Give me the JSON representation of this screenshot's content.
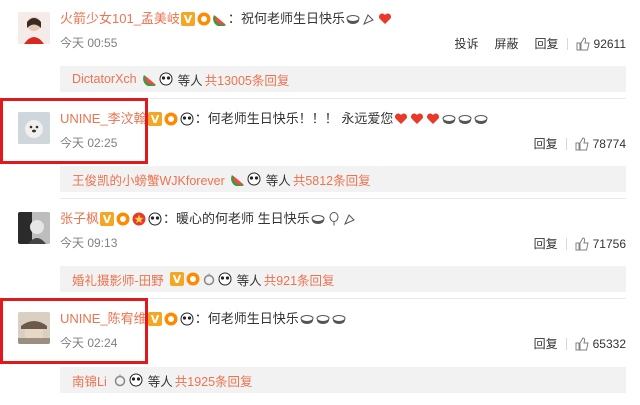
{
  "comments": [
    {
      "username": "火箭少女101_孟美岐",
      "text": "祝何老师生日快乐",
      "time": "今天 00:55",
      "actions": [
        "投诉",
        "屏蔽",
        "回复"
      ],
      "likes": "92611",
      "reply_bar": {
        "name": "DictatorXch",
        "suffix": "等人",
        "count": "共13005条回复"
      },
      "avatar_icon": "girl-red-avatar",
      "highlighted": false
    },
    {
      "username": "UNINE_李汶翰",
      "text": "何老师生日快乐！！！ 永远爱您",
      "time": "今天 02:25",
      "actions": [
        "回复"
      ],
      "likes": "78774",
      "reply_bar": {
        "name": "王俊凯的小螃蟹WJKforever",
        "suffix": "等人",
        "count": "共5812条回复"
      },
      "avatar_icon": "dog-avatar",
      "highlighted": true
    },
    {
      "username": "张子枫",
      "text": "暖心的何老师 生日快乐",
      "time": "今天 09:13",
      "actions": [
        "回复"
      ],
      "likes": "71756",
      "reply_bar": {
        "name": "婚礼摄影师-田野",
        "suffix": "等人",
        "count": "共921条回复"
      },
      "avatar_icon": "bw-portrait-avatar",
      "highlighted": false
    },
    {
      "username": "UNINE_陈宥维",
      "text": "何老师生日快乐",
      "time": "今天 02:24",
      "actions": [
        "回复"
      ],
      "likes": "65332",
      "reply_bar": {
        "name": "南锦Li",
        "suffix": "等人",
        "count": "共1925条回复"
      },
      "avatar_icon": "hat-avatar",
      "highlighted": true
    }
  ],
  "colors": {
    "username": "#eb7350",
    "highlight": "#e0191d",
    "reply_bg": "#f2f2f2",
    "time": "#808080"
  }
}
